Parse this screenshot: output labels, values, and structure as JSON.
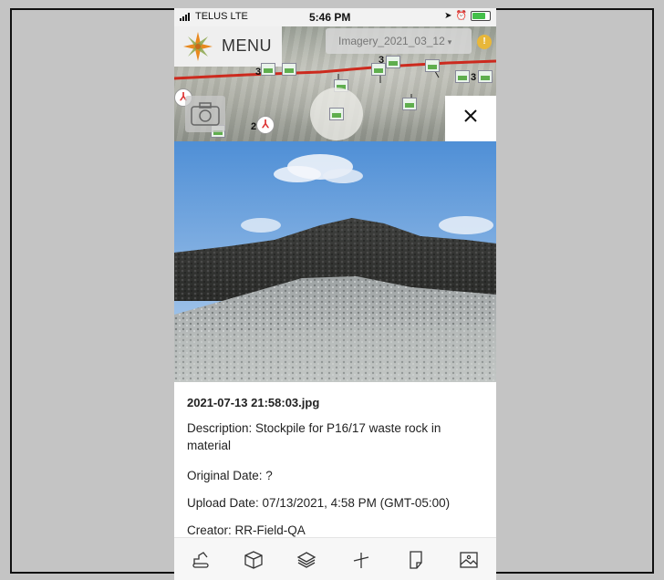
{
  "status_bar": {
    "carrier": "TELUS",
    "network": "LTE",
    "time": "5:46 PM"
  },
  "map": {
    "menu_label": "MENU",
    "imagery_label": "Imagery_2021_03_12",
    "alert_badge": "!",
    "cluster_counts": [
      "3",
      "3",
      "3",
      "2"
    ]
  },
  "photo_detail": {
    "filename": "2021-07-13 21:58:03.jpg",
    "description": "Description: Stockpile for P16/17 waste rock in material",
    "original_date": "Original Date: ?",
    "upload_date": "Upload Date: 07/13/2021, 4:58 PM (GMT-05:00)",
    "creator": "Creator: RR-Field-QA"
  },
  "toolbar": {
    "items": [
      "excavator-icon",
      "box-3d-icon",
      "layers-icon",
      "measure-icon",
      "note-icon",
      "image-icon"
    ]
  },
  "colors": {
    "route": "#cc2a1e",
    "accent_orange": "#e8891f",
    "alert": "#e8b73a"
  }
}
